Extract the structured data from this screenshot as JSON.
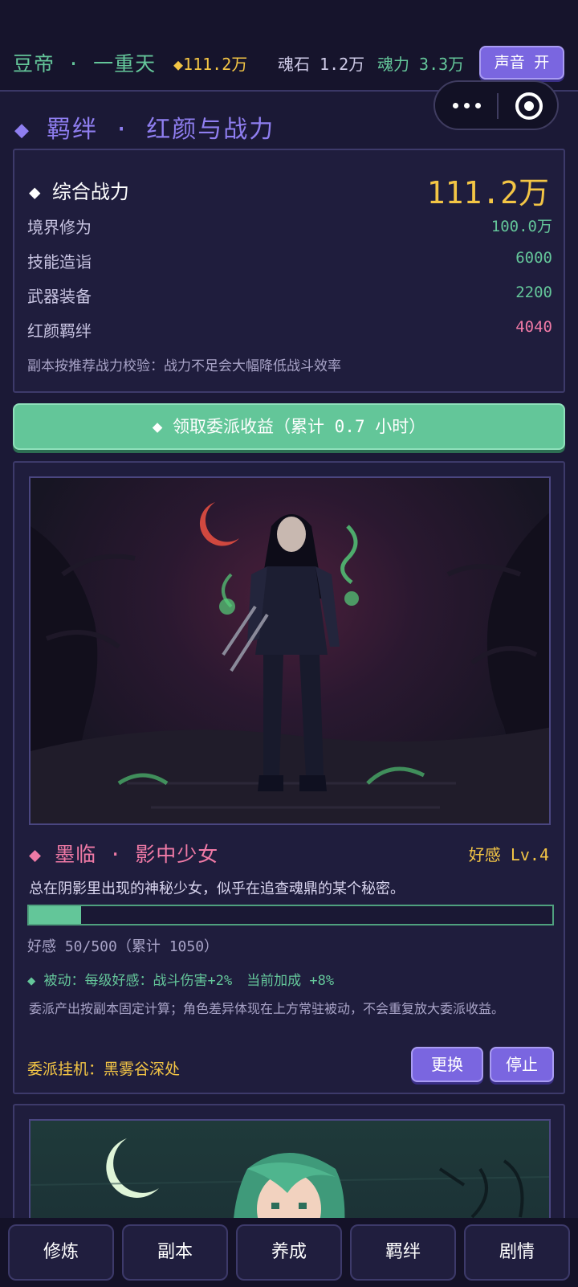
{
  "header": {
    "realm": "豆帝 · 一重天",
    "gold": "◆111.2万",
    "soulstone": "魂石 1.2万",
    "soulpower": "魂力 3.3万",
    "sound_button": "声音 开"
  },
  "section": {
    "title": "◆ 羁绊  ·  红颜与战力"
  },
  "power": {
    "title": "◆ 综合战力",
    "total": "111.2万",
    "stats": [
      {
        "label": "境界修为",
        "value": "100.0万"
      },
      {
        "label": "技能造诣",
        "value": "6000"
      },
      {
        "label": "武器装备",
        "value": "2200"
      },
      {
        "label": "红颜羁绊",
        "value": "4040"
      }
    ],
    "note": "副本按推荐战力校验：战力不足会大幅降低战斗效率"
  },
  "claim_button": "◆ 领取委派收益（累计 0.7 小时）",
  "character": {
    "name": "◆ 墨临  ·  影中少女",
    "affection_level": "好感 Lv.4",
    "description": "总在阴影里出现的神秘少女，似乎在追查魂鼎的某个秘密。",
    "affection_progress": 0.1,
    "affection_text": "好感 50/500（累计 1050）",
    "passive": "◆ 被动：每级好感：战斗伤害+2%",
    "passive_current": "当前加成 +8%",
    "dispatch_note": "委派产出按副本固定计算；角色差异体现在上方常驻被动，不会重复放大委派收益。",
    "dispatch": "委派挂机：黑雾谷深处",
    "change_button": "更换",
    "stop_button": "停止"
  },
  "nav": [
    "修炼",
    "副本",
    "养成",
    "羁绊",
    "剧情"
  ],
  "colors": {
    "background": "#1b1936",
    "accent_purple": "#7a66e0",
    "accent_green": "#63c699",
    "gold": "#f3c545",
    "pink": "#f07aa6"
  }
}
